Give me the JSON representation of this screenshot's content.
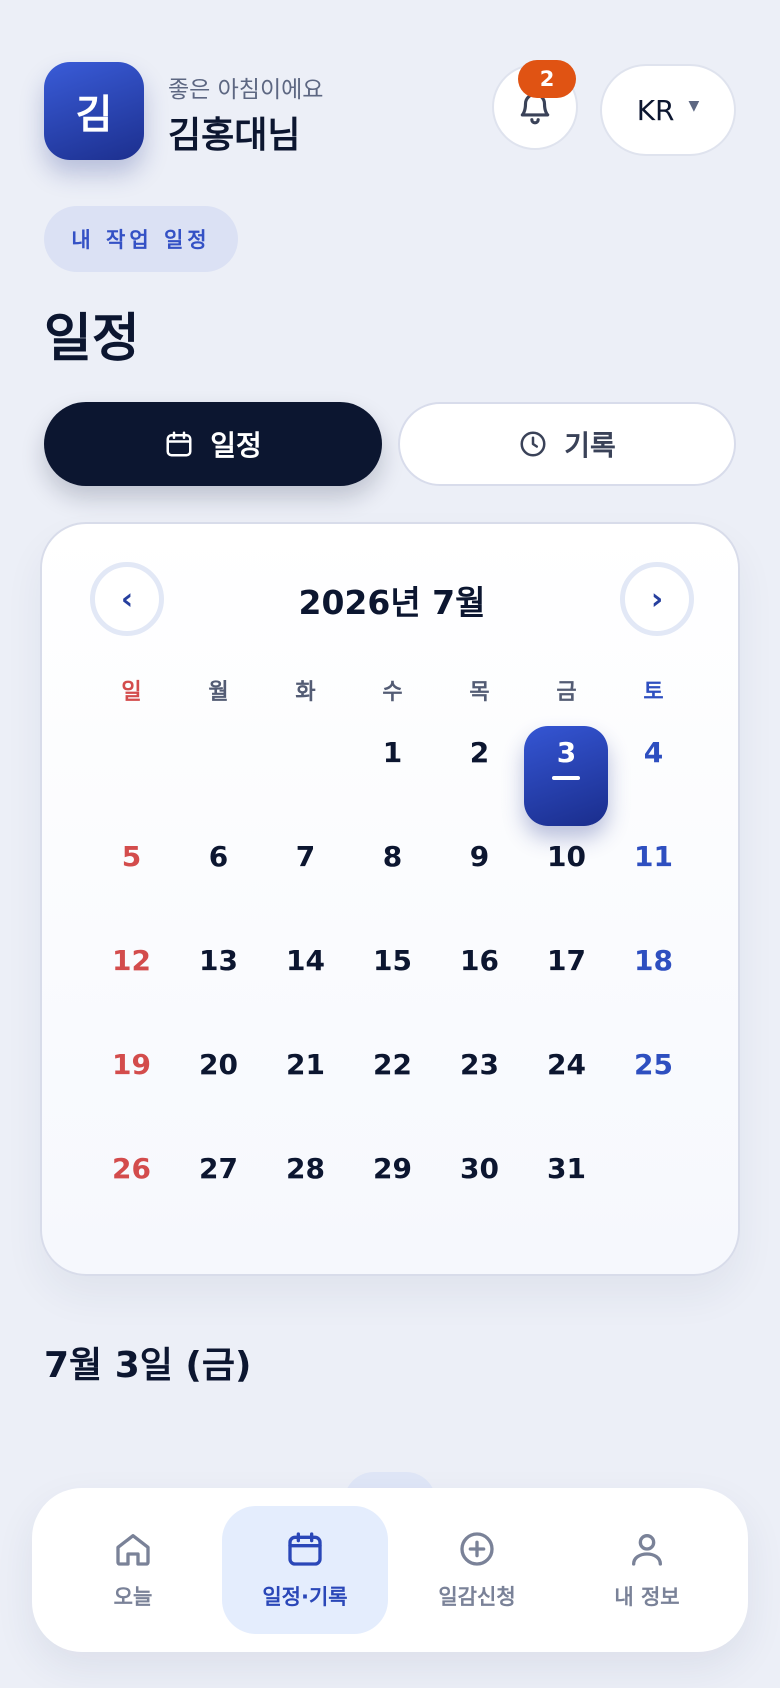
{
  "header": {
    "avatar_initial": "김",
    "greeting": "좋은 아침이에요",
    "user_name": "김홍대님",
    "notification_count": "2",
    "language": "KR"
  },
  "chip_label": "내 작업 일정",
  "page_title": "일정",
  "segments": {
    "schedule": "일정",
    "record": "기록"
  },
  "calendar": {
    "month_label": "2026년 7월",
    "prev_icon": "‹",
    "next_icon": "›",
    "weekdays": [
      "일",
      "월",
      "화",
      "수",
      "목",
      "금",
      "토"
    ],
    "selected_day": "3",
    "days": [
      "1",
      "2",
      "3",
      "4",
      "5",
      "6",
      "7",
      "8",
      "9",
      "10",
      "11",
      "12",
      "13",
      "14",
      "15",
      "16",
      "17",
      "18",
      "19",
      "20",
      "21",
      "22",
      "23",
      "24",
      "25",
      "26",
      "27",
      "28",
      "29",
      "30",
      "31"
    ]
  },
  "selected_date_label": "7월 3일 (금)",
  "bottom_nav": [
    {
      "label": "오늘",
      "icon": "home-icon"
    },
    {
      "label": "일정·기록",
      "icon": "calendar-icon"
    },
    {
      "label": "일감신청",
      "icon": "plus-circle-icon"
    },
    {
      "label": "내 정보",
      "icon": "user-icon"
    }
  ],
  "colors": {
    "accent": "#2a47b8",
    "dark": "#0c1630",
    "sunday": "#d34c4c",
    "saturday": "#2e4fc0",
    "badge": "#e05313"
  }
}
